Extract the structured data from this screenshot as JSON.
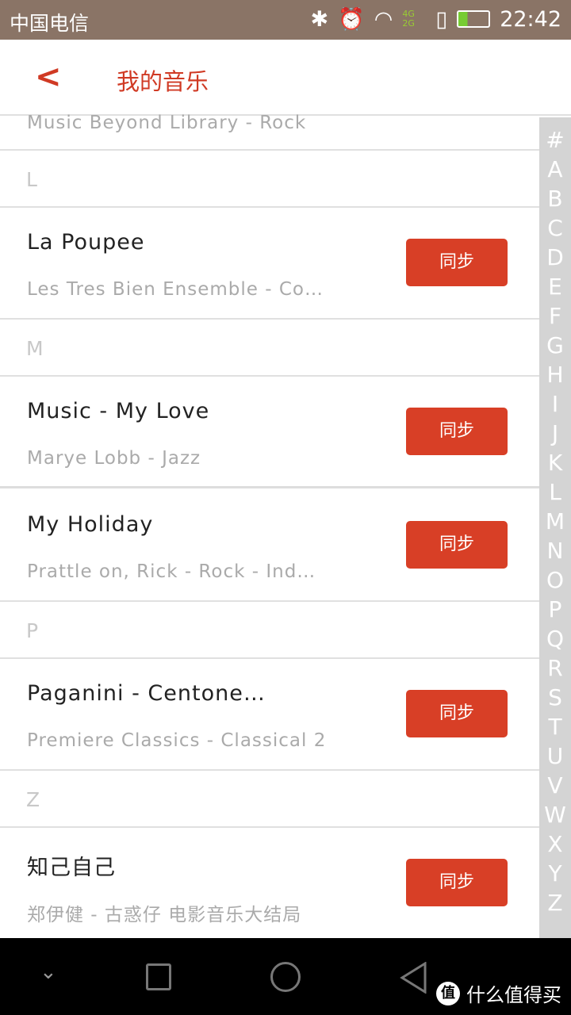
{
  "status_bar": {
    "carrier": "中国电信",
    "network": "4G 2G",
    "time": "22:42"
  },
  "header": {
    "title": "我的音乐"
  },
  "partial_item": {
    "subtitle": "Music Beyond Library - Rock"
  },
  "list": [
    {
      "type": "section",
      "label": "L"
    },
    {
      "type": "item",
      "title": "La Poupee",
      "subtitle": "Les Tres Bien Ensemble - Co…",
      "button": "同步"
    },
    {
      "type": "section",
      "label": "M"
    },
    {
      "type": "item",
      "title": "Music - My Love",
      "subtitle": "Marye Lobb - Jazz",
      "button": "同步"
    },
    {
      "type": "item",
      "title": "My Holiday",
      "subtitle": "Prattle on, Rick - Rock - Ind…",
      "button": "同步"
    },
    {
      "type": "section",
      "label": "P"
    },
    {
      "type": "item",
      "title": "Paganini - Centone…",
      "subtitle": "Premiere Classics - Classical 2",
      "button": "同步"
    },
    {
      "type": "section",
      "label": "Z"
    },
    {
      "type": "item",
      "title": "知己自己",
      "subtitle": "郑伊健 - 古惑仔 电影音乐大结局",
      "button": "同步"
    }
  ],
  "index": [
    "#",
    "A",
    "B",
    "C",
    "D",
    "E",
    "F",
    "G",
    "H",
    "I",
    "J",
    "K",
    "L",
    "M",
    "N",
    "O",
    "P",
    "Q",
    "R",
    "S",
    "T",
    "U",
    "V",
    "W",
    "X",
    "Y",
    "Z"
  ],
  "watermark": {
    "logo": "值",
    "text": "什么值得买"
  },
  "colors": {
    "accent": "#d83f26",
    "status_bar": "#8a7466"
  }
}
